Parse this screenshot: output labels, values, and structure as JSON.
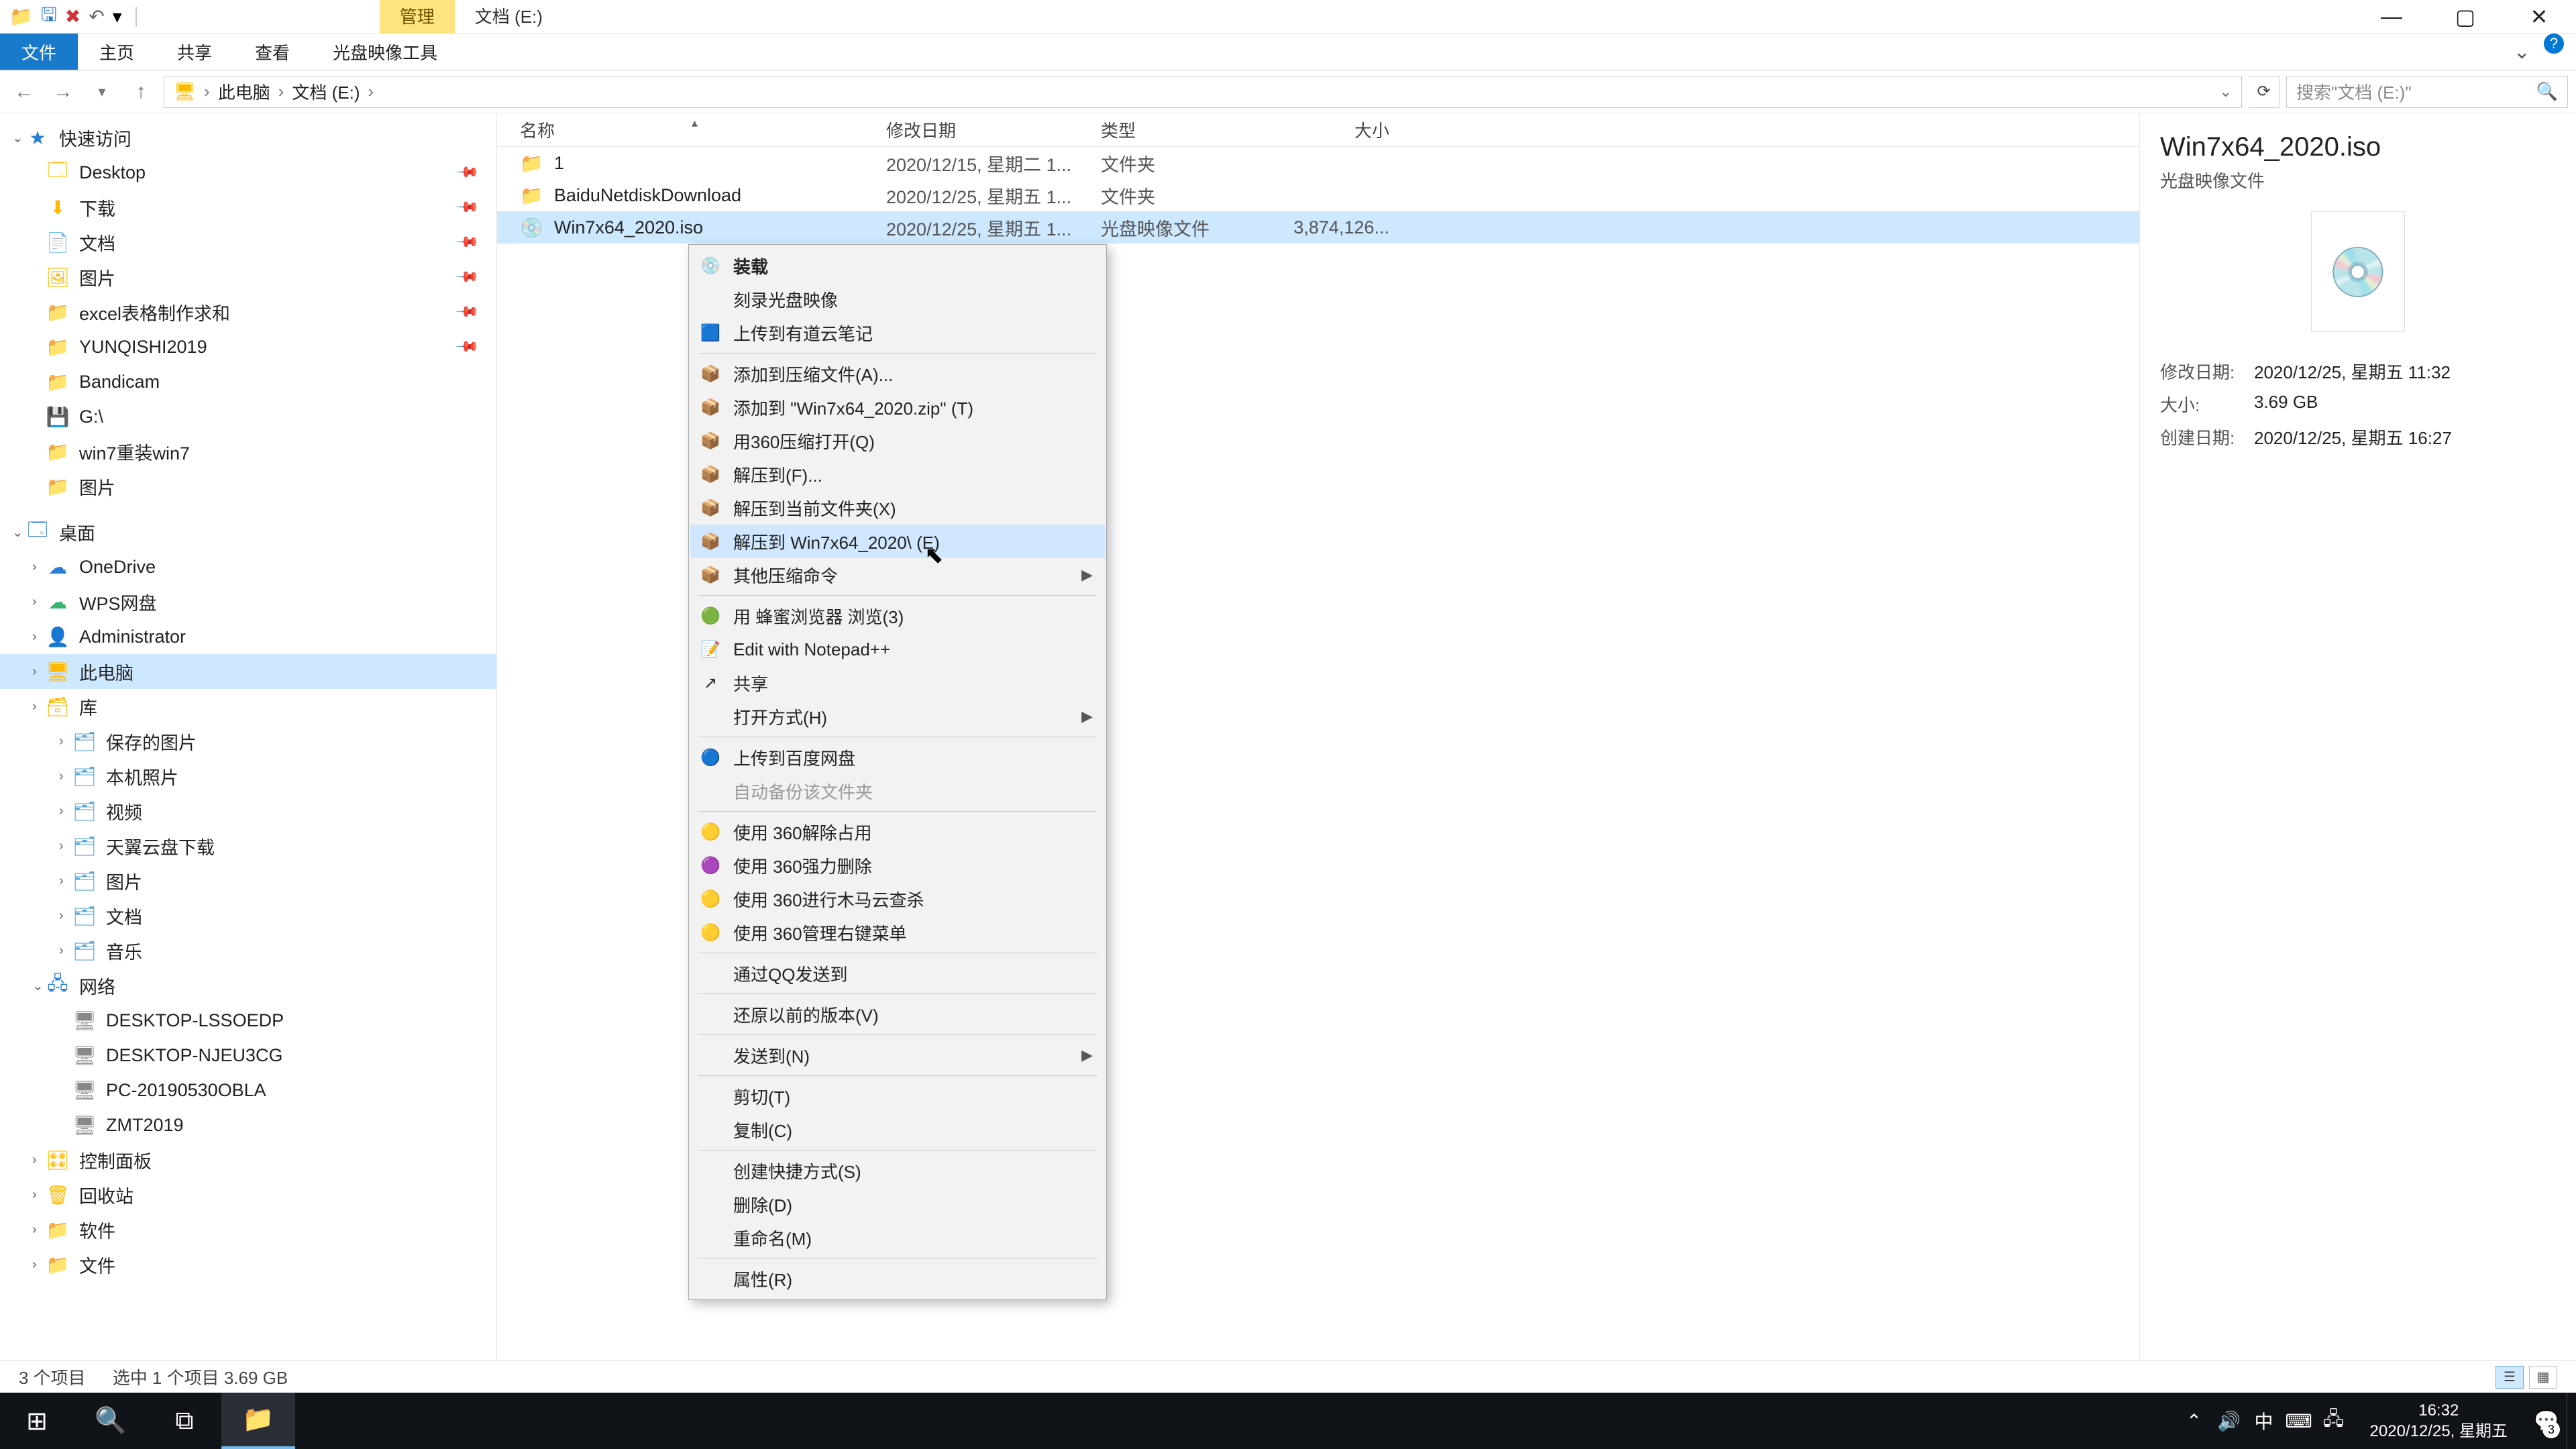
{
  "titlebar": {
    "contextual_tab": "管理",
    "window_title": "文档 (E:)"
  },
  "ribbon": {
    "tabs": [
      "文件",
      "主页",
      "共享",
      "查看",
      "光盘映像工具"
    ]
  },
  "address": {
    "crumbs": [
      "此电脑",
      "文档 (E:)"
    ],
    "search_placeholder": "搜索\"文档 (E:)\""
  },
  "nav": {
    "quick_access": "快速访问",
    "items1": [
      {
        "label": "Desktop",
        "icon": "🗔",
        "pin": true
      },
      {
        "label": "下载",
        "icon": "⬇",
        "pin": true
      },
      {
        "label": "文档",
        "icon": "📄",
        "pin": true
      },
      {
        "label": "图片",
        "icon": "🖼",
        "pin": true
      },
      {
        "label": "excel表格制作求和",
        "icon": "📁",
        "pin": true
      },
      {
        "label": "YUNQISHI2019",
        "icon": "📁",
        "pin": true
      },
      {
        "label": "Bandicam",
        "icon": "📁"
      },
      {
        "label": "G:\\",
        "icon": "💾"
      },
      {
        "label": "win7重装win7",
        "icon": "📁"
      },
      {
        "label": "图片",
        "icon": "📁"
      }
    ],
    "desktop": "桌面",
    "items2": [
      {
        "label": "OneDrive",
        "icon": "☁",
        "color": "cloud-blue"
      },
      {
        "label": "WPS网盘",
        "icon": "☁",
        "color": "green-cloud"
      },
      {
        "label": "Administrator",
        "icon": "👤"
      },
      {
        "label": "此电脑",
        "icon": "🖥",
        "selected": true
      },
      {
        "label": "库",
        "icon": "🗃"
      }
    ],
    "lib_items": [
      {
        "label": "保存的图片"
      },
      {
        "label": "本机照片"
      },
      {
        "label": "视频"
      },
      {
        "label": "天翼云盘下载"
      },
      {
        "label": "图片"
      },
      {
        "label": "文档"
      },
      {
        "label": "音乐"
      }
    ],
    "network": "网络",
    "net_items": [
      {
        "label": "DESKTOP-LSSOEDP"
      },
      {
        "label": "DESKTOP-NJEU3CG"
      },
      {
        "label": "PC-20190530OBLA"
      },
      {
        "label": "ZMT2019"
      }
    ],
    "bottom_items": [
      {
        "label": "控制面板",
        "icon": "🎛"
      },
      {
        "label": "回收站",
        "icon": "🗑"
      },
      {
        "label": "软件",
        "icon": "📁"
      },
      {
        "label": "文件",
        "icon": "📁"
      }
    ]
  },
  "columns": {
    "name": "名称",
    "date": "修改日期",
    "type": "类型",
    "size": "大小"
  },
  "files": [
    {
      "name": "1",
      "date": "2020/12/15, 星期二 1...",
      "type": "文件夹",
      "size": "",
      "icon": "📁"
    },
    {
      "name": "BaiduNetdiskDownload",
      "date": "2020/12/25, 星期五 1...",
      "type": "文件夹",
      "size": "",
      "icon": "📁"
    },
    {
      "name": "Win7x64_2020.iso",
      "date": "2020/12/25, 星期五 1...",
      "type": "光盘映像文件",
      "size": "3,874,126...",
      "icon": "💿",
      "selected": true
    }
  ],
  "context_menu": [
    {
      "label": "装载",
      "bold": true,
      "icon": "💿"
    },
    {
      "label": "刻录光盘映像"
    },
    {
      "label": "上传到有道云笔记",
      "icon": "🟦"
    },
    {
      "sep": true
    },
    {
      "label": "添加到压缩文件(A)...",
      "icon": "📦"
    },
    {
      "label": "添加到 \"Win7x64_2020.zip\" (T)",
      "icon": "📦"
    },
    {
      "label": "用360压缩打开(Q)",
      "icon": "📦"
    },
    {
      "label": "解压到(F)...",
      "icon": "📦"
    },
    {
      "label": "解压到当前文件夹(X)",
      "icon": "📦"
    },
    {
      "label": "解压到 Win7x64_2020\\ (E)",
      "icon": "📦",
      "hover": true
    },
    {
      "label": "其他压缩命令",
      "icon": "📦",
      "sub": true
    },
    {
      "sep": true
    },
    {
      "label": "用 蜂蜜浏览器 浏览(3)",
      "icon": "🟢"
    },
    {
      "label": "Edit with Notepad++",
      "icon": "📝"
    },
    {
      "label": "共享",
      "icon": "↗"
    },
    {
      "label": "打开方式(H)",
      "sub": true
    },
    {
      "sep": true
    },
    {
      "label": "上传到百度网盘",
      "icon": "🔵"
    },
    {
      "label": "自动备份该文件夹",
      "disabled": true
    },
    {
      "sep": true
    },
    {
      "label": "使用 360解除占用",
      "icon": "🟡"
    },
    {
      "label": "使用 360强力删除",
      "icon": "🟣"
    },
    {
      "label": "使用 360进行木马云查杀",
      "icon": "🟡"
    },
    {
      "label": "使用 360管理右键菜单",
      "icon": "🟡"
    },
    {
      "sep": true
    },
    {
      "label": "通过QQ发送到"
    },
    {
      "sep": true
    },
    {
      "label": "还原以前的版本(V)"
    },
    {
      "sep": true
    },
    {
      "label": "发送到(N)",
      "sub": true
    },
    {
      "sep": true
    },
    {
      "label": "剪切(T)"
    },
    {
      "label": "复制(C)"
    },
    {
      "sep": true
    },
    {
      "label": "创建快捷方式(S)"
    },
    {
      "label": "删除(D)"
    },
    {
      "label": "重命名(M)"
    },
    {
      "sep": true
    },
    {
      "label": "属性(R)"
    }
  ],
  "details": {
    "title": "Win7x64_2020.iso",
    "subtitle": "光盘映像文件",
    "rows": [
      {
        "label": "修改日期:",
        "value": "2020/12/25, 星期五 11:32"
      },
      {
        "label": "大小:",
        "value": "3.69 GB"
      },
      {
        "label": "创建日期:",
        "value": "2020/12/25, 星期五 16:27"
      }
    ]
  },
  "statusbar": {
    "items": "3 个项目",
    "selection": "选中 1 个项目  3.69 GB"
  },
  "taskbar": {
    "time": "16:32",
    "date": "2020/12/25, 星期五",
    "ime": "中",
    "notif_count": "3"
  }
}
